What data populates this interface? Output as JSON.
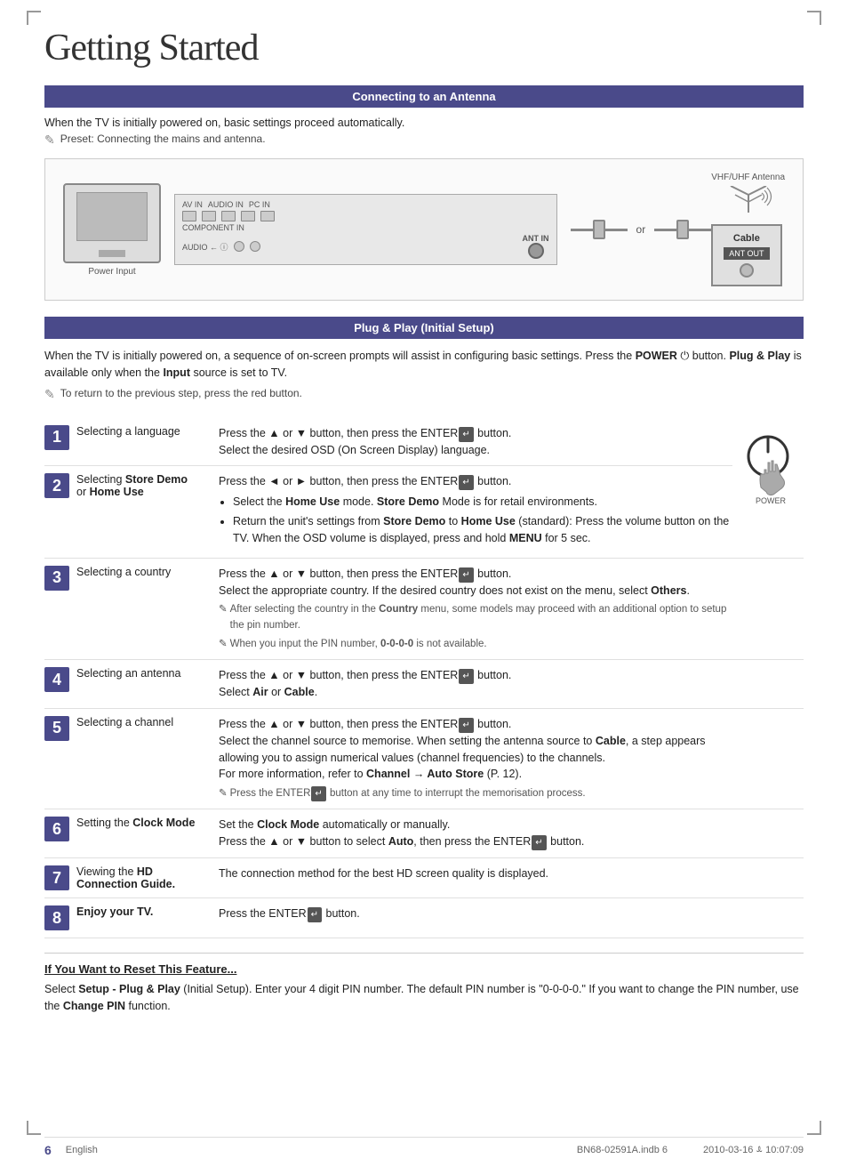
{
  "page": {
    "title": "Getting Started",
    "page_number": "6",
    "language": "English",
    "footer_file": "BN68-02591A.indb   6",
    "footer_date": "2010-03-16   ꕊ  10:07:09"
  },
  "sections": {
    "antenna": {
      "header": "Connecting to an Antenna",
      "intro1": "When the TV is initially powered on, basic settings proceed automatically.",
      "note": "Preset: Connecting the mains and antenna.",
      "labels": {
        "power_input": "Power Input",
        "vhf_uhf": "VHF/UHF Antenna",
        "cable": "Cable",
        "ant_out": "ANT OUT",
        "ant_in": "ANT IN",
        "or": "or"
      }
    },
    "plug_play": {
      "header": "Plug & Play (Initial Setup)",
      "intro": "When the TV is initially powered on, a sequence of on-screen prompts will assist in configuring basic settings. Press the POWER  button. Plug & Play is available only when the Input source is set to TV.",
      "note": "To return to the previous step, press the red button.",
      "steps": [
        {
          "num": "1",
          "title": "Selecting a language",
          "content": "Press the ▲ or ▼ button, then press the ENTER  button.\nSelect the desired OSD (On Screen Display) language."
        },
        {
          "num": "2",
          "title": "Selecting Store Demo or Home Use",
          "content_main": "Press the ◄ or ► button, then press the ENTER  button.",
          "bullets": [
            "Select the Home Use mode. Store Demo Mode is for retail environments.",
            "Return the unit's settings from Store Demo to Home Use (standard): Press the volume button on the TV. When the OSD volume is displayed, press and hold MENU for 5 sec."
          ]
        },
        {
          "num": "3",
          "title": "Selecting a country",
          "content": "Press the ▲ or ▼ button, then press the ENTER  button.\nSelect the appropriate country. If the desired country does not exist on the menu, select Others.",
          "notes": [
            "After selecting the country in the Country menu, some models may proceed with an additional option to setup the pin number.",
            "When you input the PIN number, 0-0-0-0 is not available."
          ]
        },
        {
          "num": "4",
          "title": "Selecting an antenna",
          "content": "Press the ▲ or ▼ button, then press the ENTER  button.\nSelect Air or Cable."
        },
        {
          "num": "5",
          "title": "Selecting a channel",
          "content_main": "Press the ▲ or ▼ button, then press the ENTER  button.\nSelect the channel source to memorise. When setting the antenna source to Cable, a step appears allowing you to assign numerical values (channel frequencies) to the channels.\nFor more information, refer to Channel → Auto Store (P. 12).",
          "note": "Press the ENTER  button at any time to interrupt the memorisation process."
        },
        {
          "num": "6",
          "title": "Setting the Clock Mode",
          "content": "Set the Clock Mode automatically or manually.\nPress the ▲ or ▼ button to select Auto, then press the ENTER  button."
        },
        {
          "num": "7",
          "title": "Viewing the HD Connection Guide.",
          "content": "The connection method for the best HD screen quality is displayed."
        },
        {
          "num": "8",
          "title": "Enjoy your TV.",
          "content": "Press the ENTER  button."
        }
      ]
    },
    "reset": {
      "title": "If You Want to Reset This Feature...",
      "text": "Select Setup - Plug & Play (Initial Setup). Enter your 4 digit PIN number. The default PIN number is \"0-0-0-0.\" If you want to change the PIN number, use the Change PIN function."
    }
  }
}
